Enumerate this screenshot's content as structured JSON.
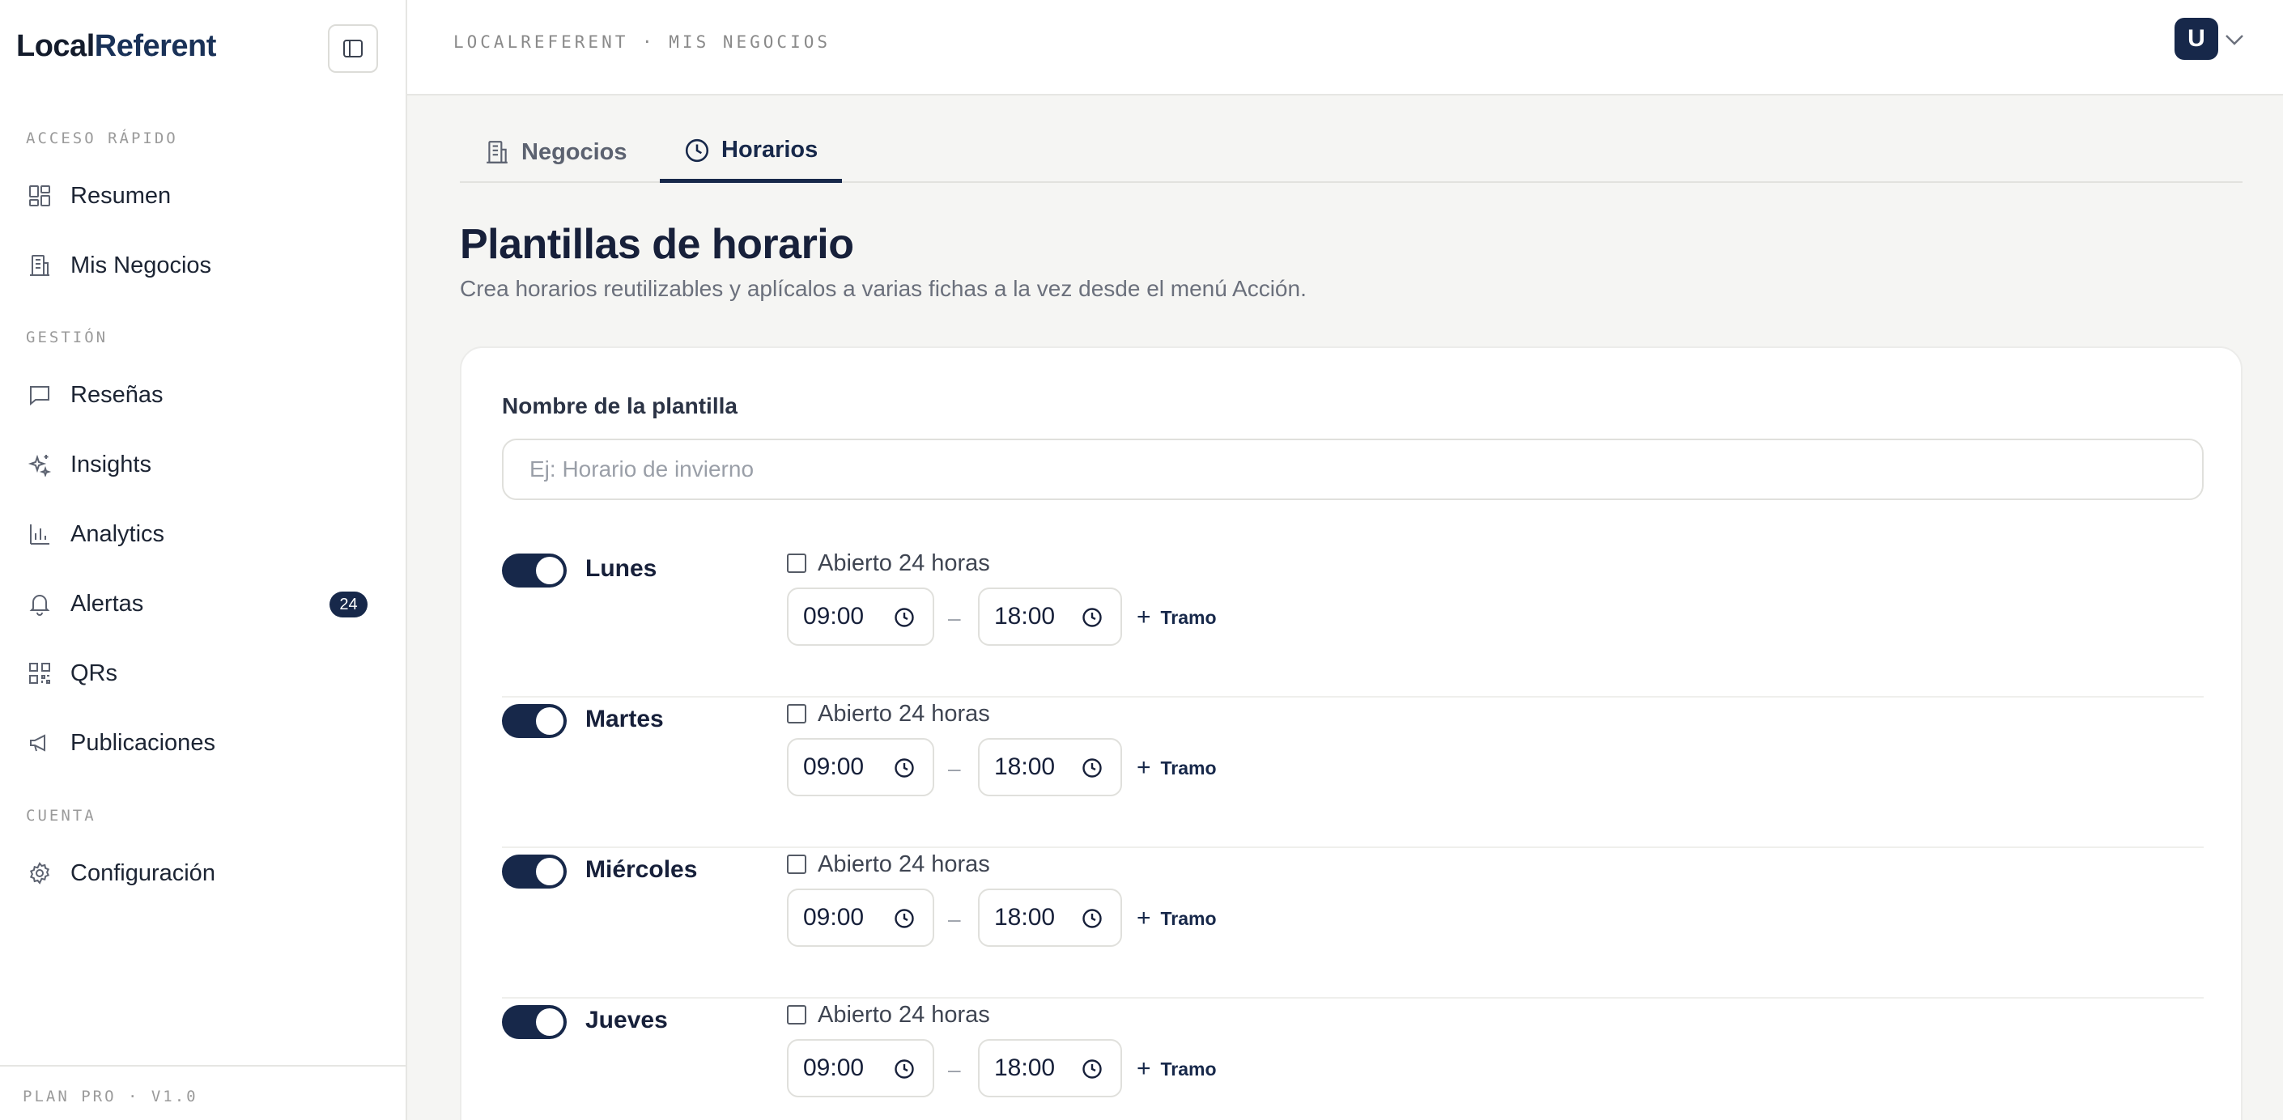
{
  "app": {
    "logo_part1": "Local",
    "logo_part2": "Referent"
  },
  "sidebar": {
    "sections": [
      {
        "title": "ACCESO RÁPIDO"
      },
      {
        "title": "GESTIÓN"
      },
      {
        "title": "CUENTA"
      }
    ],
    "items": [
      {
        "label": "Resumen",
        "icon": "grid-icon"
      },
      {
        "label": "Mis Negocios",
        "icon": "building-icon"
      },
      {
        "label": "Reseñas",
        "icon": "message-icon"
      },
      {
        "label": "Insights",
        "icon": "sparkles-icon"
      },
      {
        "label": "Analytics",
        "icon": "bar-chart-icon"
      },
      {
        "label": "Alertas",
        "icon": "bell-icon",
        "badge": "24"
      },
      {
        "label": "QRs",
        "icon": "qr-code-icon"
      },
      {
        "label": "Publicaciones",
        "icon": "megaphone-icon"
      },
      {
        "label": "Configuración",
        "icon": "gear-icon"
      }
    ],
    "footer": "PLAN PRO · V1.0"
  },
  "header": {
    "breadcrumb": "LOCALREFERENT · MIS NEGOCIOS",
    "avatar_initial": "U"
  },
  "tabs": [
    {
      "label": "Negocios",
      "icon": "building-icon",
      "active": false
    },
    {
      "label": "Horarios",
      "icon": "clock-icon",
      "active": true
    }
  ],
  "page": {
    "title": "Plantillas de horario",
    "subtitle": "Crea horarios reutilizables y aplícalos a varias fichas a la vez desde el menú Acción."
  },
  "form": {
    "name_label": "Nombre de la plantilla",
    "name_placeholder": "Ej: Horario de invierno",
    "name_value": "",
    "open24_label": "Abierto 24 horas",
    "add_slot_label": "Tramo",
    "days": [
      {
        "name": "Lunes",
        "enabled": true,
        "open24": false,
        "from": "09:00",
        "to": "18:00"
      },
      {
        "name": "Martes",
        "enabled": true,
        "open24": false,
        "from": "09:00",
        "to": "18:00"
      },
      {
        "name": "Miércoles",
        "enabled": true,
        "open24": false,
        "from": "09:00",
        "to": "18:00"
      },
      {
        "name": "Jueves",
        "enabled": true,
        "open24": false,
        "from": "09:00",
        "to": "18:00"
      }
    ]
  },
  "colors": {
    "accent": "#17284a",
    "background": "#f5f5f3",
    "surface": "#ffffff",
    "muted_text": "#6b707c"
  }
}
